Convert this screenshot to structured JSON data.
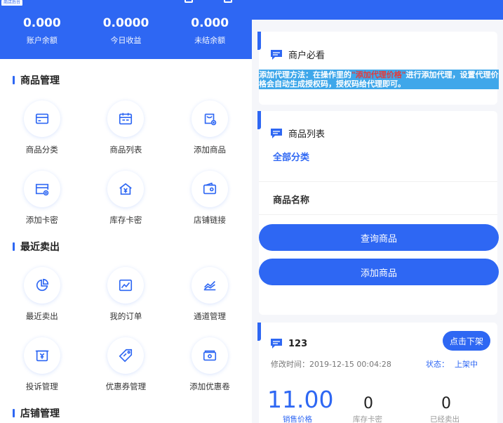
{
  "header": {
    "brand_tag": "商店后台",
    "stats": [
      {
        "value": "0.000",
        "label": "账户余额"
      },
      {
        "value": "0.0000",
        "label": "今日收益"
      },
      {
        "value": "0.000",
        "label": "未结余额"
      }
    ]
  },
  "sections": [
    {
      "title": "商品管理",
      "items": [
        {
          "label": "商品分类",
          "icon": "card-icon"
        },
        {
          "label": "商品列表",
          "icon": "calendar-icon"
        },
        {
          "label": "添加商品",
          "icon": "bag-plus-icon"
        },
        {
          "label": "添加卡密",
          "icon": "card-plus-icon"
        },
        {
          "label": "库存卡密",
          "icon": "house-yen-icon"
        },
        {
          "label": "店铺链接",
          "icon": "wallet-icon"
        }
      ]
    },
    {
      "title": "最近卖出",
      "items": [
        {
          "label": "最近卖出",
          "icon": "pie-chart-icon"
        },
        {
          "label": "我的订单",
          "icon": "line-chart-icon"
        },
        {
          "label": "通道管理",
          "icon": "area-chart-icon"
        },
        {
          "label": "投诉管理",
          "icon": "yen-box-icon"
        },
        {
          "label": "优惠券管理",
          "icon": "tag-icon"
        },
        {
          "label": "添加优惠卷",
          "icon": "voucher-icon"
        }
      ]
    },
    {
      "title": "店铺管理",
      "items": []
    }
  ],
  "notice_card": {
    "title": "商户必看",
    "text_before": "添加代理方法：在操作里的",
    "text_highlight": "\"添加代理价格\"",
    "text_after": "进行添加代理，设置代理价格会自动生成授权码，授权码给代理即可。"
  },
  "list_card": {
    "title": "商品列表",
    "category": "全部分类",
    "name_label": "商品名称",
    "query_button": "查询商品",
    "add_button": "添加商品"
  },
  "product": {
    "name": "123",
    "action": "点击下架",
    "modified_label": "修改时间：",
    "modified_value": "2019-12-15 00:04:28",
    "status_label": "状态：",
    "status_value": "上架中",
    "price": "11.00",
    "price_label": "销售价格",
    "stock": "0",
    "stock_label": "库存卡密",
    "sold": "0",
    "sold_label": "已经卖出"
  },
  "colors": {
    "primary": "#2e67f3",
    "notice_bg": "#3fa7ea",
    "highlight": "#e33b3b"
  }
}
